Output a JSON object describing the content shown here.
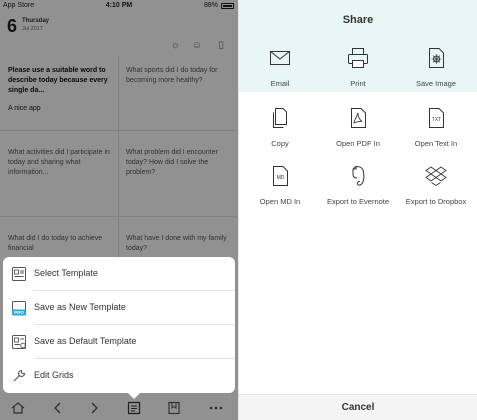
{
  "left": {
    "status_bar": {
      "carrier": "App Store",
      "time": "4:10 PM",
      "battery": "88%"
    },
    "date": {
      "day": "6",
      "weekday": "Thursday",
      "month_year": "Jul 2017"
    },
    "grid": {
      "cells": [
        {
          "prompt": "Please use a suitable word to describe today because every single da...",
          "answer": "A nice app",
          "active": true
        },
        {
          "prompt": "What sports did I do today for becoming more healthy?",
          "answer": "",
          "active": false
        },
        {
          "prompt": "What activities did I participate in today and sharing what information...",
          "answer": "",
          "active": false
        },
        {
          "prompt": "What problem did I encounter today? How did I solve the problem?",
          "answer": "",
          "active": false
        },
        {
          "prompt": "What did I do today to achieve financial",
          "answer": "",
          "active": false
        },
        {
          "prompt": "What have I done with my family today?",
          "answer": "",
          "active": false
        }
      ]
    },
    "sheet": {
      "items": [
        {
          "label": "Select Template",
          "icon": "template-icon"
        },
        {
          "label": "Save as New Template",
          "icon": "new-template-pro-icon",
          "badge": "PRO"
        },
        {
          "label": "Save as Default Template",
          "icon": "default-template-icon"
        },
        {
          "label": "Edit Grids",
          "icon": "wrench-icon"
        }
      ]
    },
    "tabbar": [
      "home-icon",
      "back-icon",
      "forward-icon",
      "template-icon",
      "bookmark-icon",
      "more-icon"
    ]
  },
  "share": {
    "title": "Share",
    "options": [
      {
        "label": "Email",
        "icon": "email-icon"
      },
      {
        "label": "Print",
        "icon": "printer-icon"
      },
      {
        "label": "Save Image",
        "icon": "image-icon"
      },
      {
        "label": "Copy",
        "icon": "copy-icon"
      },
      {
        "label": "Open PDF In",
        "icon": "pdf-icon"
      },
      {
        "label": "Open Text In",
        "icon": "txt-file-icon",
        "badge": "TXT"
      },
      {
        "label": "Open MD In",
        "icon": "md-file-icon",
        "badge": "MD"
      },
      {
        "label": "Export to Evernote",
        "icon": "evernote-icon"
      },
      {
        "label": "Export to Dropbox",
        "icon": "dropbox-icon"
      }
    ],
    "cancel": "Cancel"
  },
  "colors": {
    "accent_tint": "#e6f5f4",
    "pro_badge": "#29a8d8",
    "dim": "#000000"
  }
}
